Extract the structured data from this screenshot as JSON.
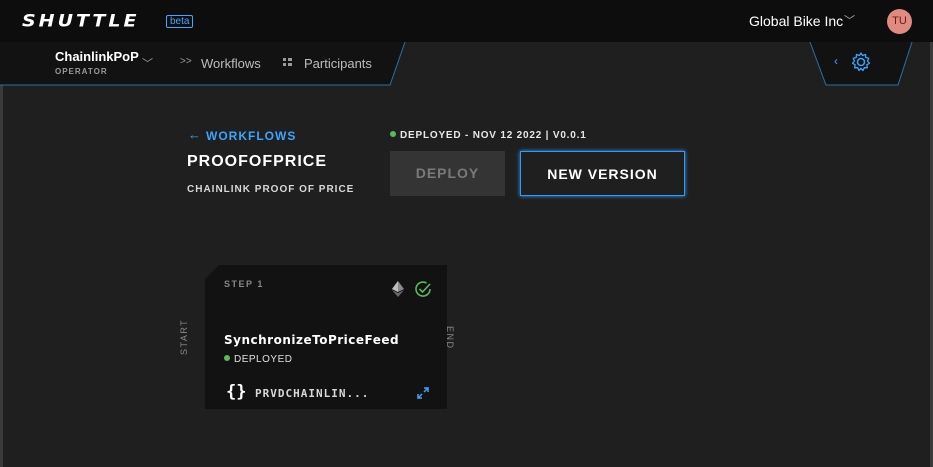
{
  "app": {
    "logo": "SHUTTLE",
    "badge": "beta"
  },
  "header": {
    "org_name": "Global Bike Inc",
    "user_initials": "TU"
  },
  "project": {
    "name": "ChainlinkPoP",
    "role": "OPERATOR"
  },
  "nav": {
    "workflows": "Workflows",
    "participants": "Participants"
  },
  "workflow": {
    "back_label": "WORKFLOWS",
    "title": "PROOFOFPRICE",
    "subtitle": "CHAINLINK PROOF OF PRICE",
    "status": "DEPLOYED - NOV 12 2022 | V0.0.1",
    "deploy_label": "DEPLOY",
    "new_version_label": "NEW VERSION"
  },
  "canvas": {
    "start_label": "START",
    "end_label": "END",
    "step": {
      "step_label": "STEP 1",
      "name": "SynchronizeToPriceFeed",
      "status": "DEPLOYED",
      "braces": "{}",
      "contract": "PRVDCHAINLIN..."
    }
  },
  "colors": {
    "accent": "#39a5ff",
    "deployed": "#5cb85c",
    "avatar": "#e08a82"
  }
}
